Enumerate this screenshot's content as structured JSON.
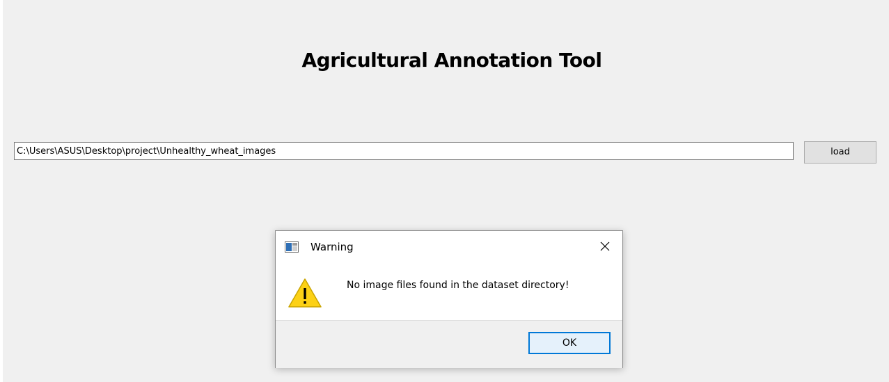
{
  "app": {
    "title": "Agricultural Annotation Tool"
  },
  "path_input": {
    "value": "C:\\Users\\ASUS\\Desktop\\project\\Unhealthy_wheat_images"
  },
  "load_button": {
    "label": "load"
  },
  "dialog": {
    "title": "Warning",
    "message": "No image files found in the dataset directory!",
    "ok_label": "OK",
    "icons": {
      "app": "window-app-icon",
      "close": "close-icon",
      "warning": "warning-icon"
    }
  },
  "colors": {
    "window_bg": "#f0f0f0",
    "accent_focus": "#0078d7",
    "warning_yellow": "#fcd116"
  }
}
